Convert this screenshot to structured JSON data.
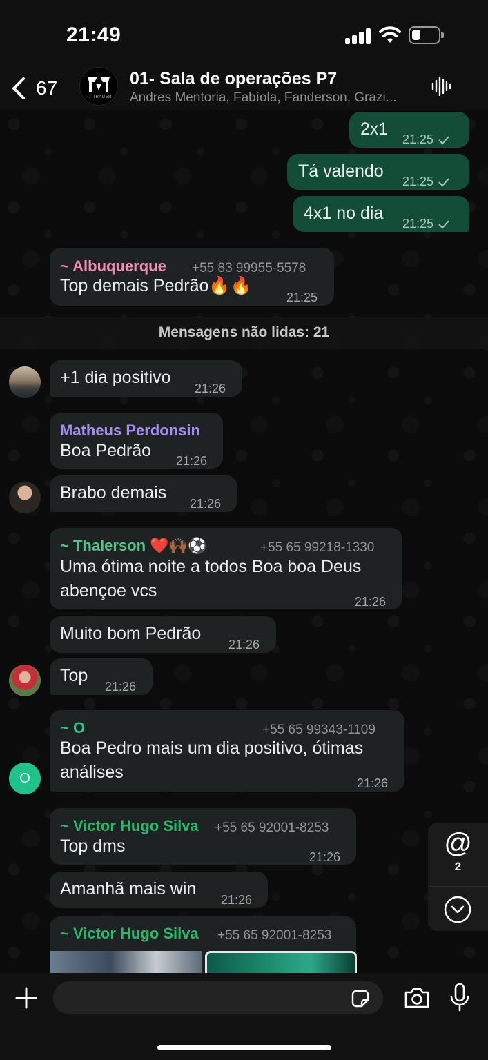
{
  "status_bar": {
    "time": "21:49"
  },
  "header": {
    "back_count": "67",
    "title": "01- Sala de operações P7",
    "members": "Andres Mentoria, Fabíola, Fanderson, Grazi...",
    "avatar_logo_text": "P7 TRADER"
  },
  "outgoing": [
    {
      "text": "2x1",
      "time": "21:25"
    },
    {
      "text": "Tá valendo",
      "time": "21:25"
    },
    {
      "text": "4x1 no dia",
      "time": "21:25"
    }
  ],
  "msg_albuquerque": {
    "sender": "~ Albuquerque",
    "phone": "+55 83 99955-5578",
    "text": "Top demais Pedrão🔥🔥",
    "time": "21:25",
    "sender_color": "#f28db0"
  },
  "unread_divider": "Mensagens não lidas: 21",
  "msg_dia_positivo": {
    "text": "+1 dia positivo",
    "time": "21:26"
  },
  "msg_matheus": {
    "sender": "Matheus Perdonsin",
    "text": "Boa Pedrão",
    "time": "21:26",
    "sender_color": "#a68ff2"
  },
  "msg_brabo": {
    "text": "Brabo demais",
    "time": "21:26"
  },
  "msg_thalerson": {
    "sender": "~ Thalerson ❤️🙌🏾⚽",
    "phone": "+55 65 99218-1330",
    "line1": "Uma ótima noite a todos Boa boa Deus",
    "line2": "abençoe vcs",
    "time": "21:26",
    "sender_color": "#53c38a"
  },
  "msg_muito_bom": {
    "text": "Muito bom Pedrão",
    "time": "21:26"
  },
  "msg_top": {
    "text": "Top",
    "time": "21:26"
  },
  "msg_o": {
    "sender": "~ O",
    "phone": "+55 65 99343-1109",
    "line1": "Boa Pedro mais um dia positivo, ótimas",
    "line2": "análises",
    "time": "21:26",
    "avatar_letter": "O",
    "sender_color": "#28c48a"
  },
  "msg_victor1": {
    "sender": "~ Victor Hugo Silva",
    "phone": "+55 65 92001-8253",
    "text": "Top dms",
    "time": "21:26",
    "sender_color": "#29b86a"
  },
  "msg_amanha": {
    "text": "Amanhã mais win",
    "time": "21:26"
  },
  "msg_victor2": {
    "sender": "~ Victor Hugo Silva",
    "phone": "+55 65 92001-8253"
  },
  "jump_panel": {
    "mention_symbol": "@",
    "mention_count": "2"
  },
  "input": {
    "placeholder": "",
    "value": ""
  },
  "colors": {
    "outgoing_bubble": "#134d37",
    "incoming_bubble": "#1f2223",
    "background": "#0b0b0b"
  }
}
